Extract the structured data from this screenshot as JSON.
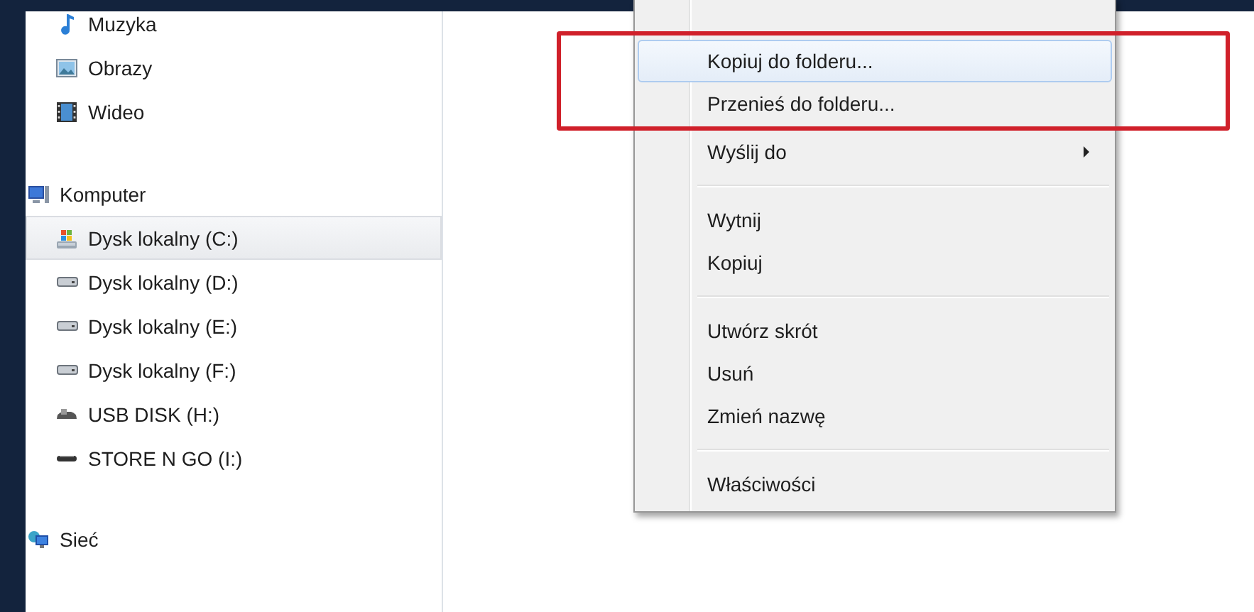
{
  "sidebar": {
    "groups": [
      {
        "items": [
          {
            "label": "Muzyka",
            "kind": "music",
            "selected": false
          },
          {
            "label": "Obrazy",
            "kind": "pictures",
            "selected": false
          },
          {
            "label": "Wideo",
            "kind": "video",
            "selected": false
          }
        ]
      },
      {
        "label": "Komputer",
        "kind": "computer",
        "items": [
          {
            "label": "Dysk lokalny (C:)",
            "kind": "system-drive",
            "selected": true
          },
          {
            "label": "Dysk lokalny (D:)",
            "kind": "drive",
            "selected": false
          },
          {
            "label": "Dysk lokalny (E:)",
            "kind": "drive",
            "selected": false
          },
          {
            "label": "Dysk lokalny (F:)",
            "kind": "drive",
            "selected": false
          },
          {
            "label": "USB DISK (H:)",
            "kind": "usb",
            "selected": false
          },
          {
            "label": "STORE N GO (I:)",
            "kind": "flat-drive",
            "selected": false
          }
        ]
      },
      {
        "label": "Sieć",
        "kind": "network"
      }
    ]
  },
  "context_menu": {
    "items": [
      {
        "kind": "item",
        "label": "Kopiuj do folderu...",
        "selected": true,
        "submenu": false,
        "marked": true
      },
      {
        "kind": "item",
        "label": "Przenieś do folderu...",
        "selected": false,
        "submenu": false,
        "marked": true
      },
      {
        "kind": "item",
        "label": "Wyślij do",
        "selected": false,
        "submenu": true,
        "marked": false
      },
      {
        "kind": "separator"
      },
      {
        "kind": "item",
        "label": "Wytnij",
        "selected": false,
        "submenu": false,
        "marked": false
      },
      {
        "kind": "item",
        "label": "Kopiuj",
        "selected": false,
        "submenu": false,
        "marked": false
      },
      {
        "kind": "separator"
      },
      {
        "kind": "item",
        "label": "Utwórz skrót",
        "selected": false,
        "submenu": false,
        "marked": false
      },
      {
        "kind": "item",
        "label": "Usuń",
        "selected": false,
        "submenu": false,
        "marked": false
      },
      {
        "kind": "item",
        "label": "Zmień nazwę",
        "selected": false,
        "submenu": false,
        "marked": false
      },
      {
        "kind": "separator"
      },
      {
        "kind": "item",
        "label": "Właściwości",
        "selected": false,
        "submenu": false,
        "marked": false
      }
    ]
  }
}
